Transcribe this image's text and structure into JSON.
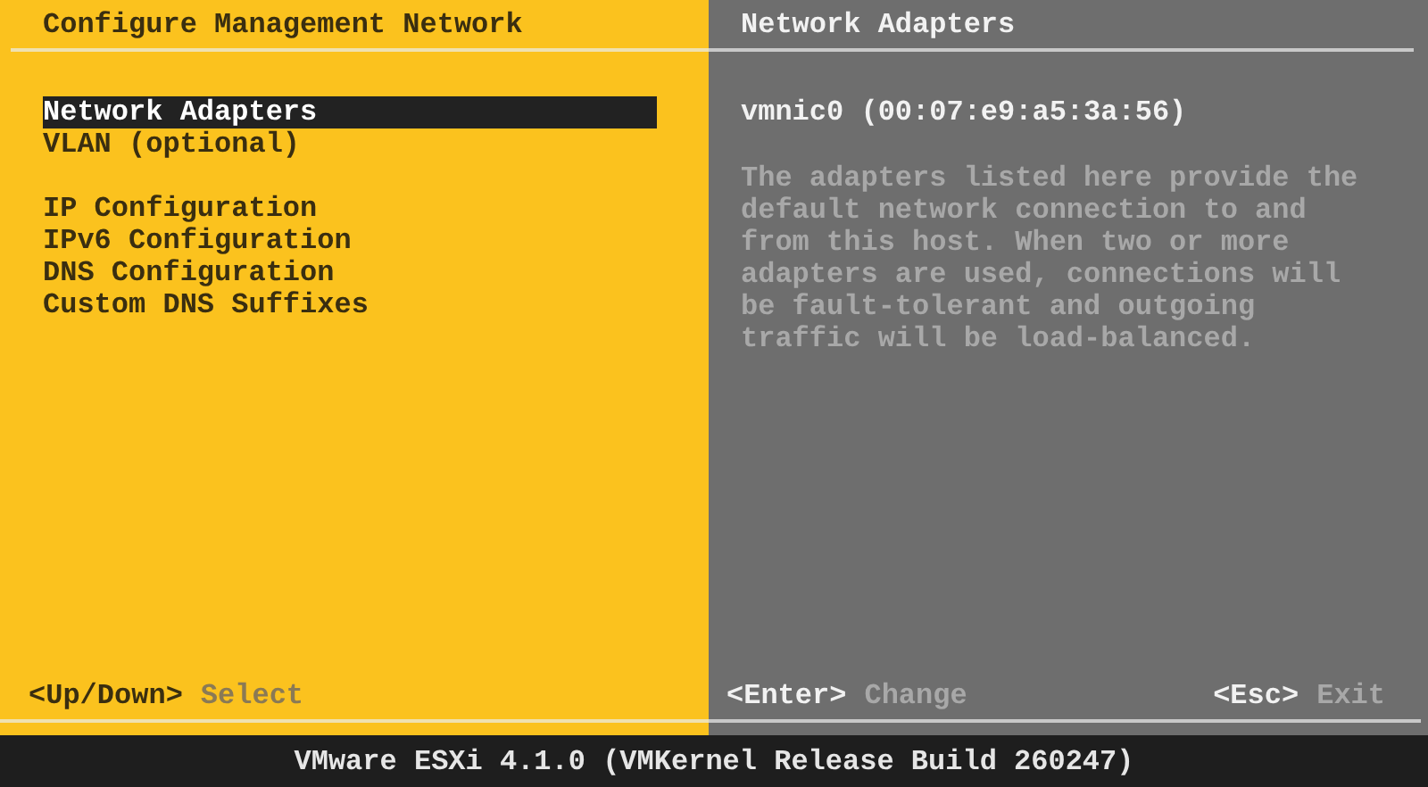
{
  "left_panel": {
    "title": "Configure Management Network",
    "menu_groups": [
      {
        "items": [
          {
            "label": "Network Adapters",
            "selected": true
          },
          {
            "label": "VLAN (optional)",
            "selected": false
          }
        ]
      },
      {
        "items": [
          {
            "label": "IP Configuration",
            "selected": false
          },
          {
            "label": "IPv6 Configuration",
            "selected": false
          },
          {
            "label": "DNS Configuration",
            "selected": false
          },
          {
            "label": "Custom DNS Suffixes",
            "selected": false
          }
        ]
      }
    ],
    "hints": [
      {
        "key": "<Up/Down>",
        "action": "Select"
      }
    ]
  },
  "right_panel": {
    "title": "Network Adapters",
    "adapter": "vmnic0 (00:07:e9:a5:3a:56)",
    "description": "The adapters listed here provide the default network connection to and from this host. When two or more adapters are used, connections will be fault-tolerant and outgoing traffic will be load-balanced.",
    "hints": [
      {
        "key": "<Enter>",
        "action": "Change"
      },
      {
        "key": "<Esc>",
        "action": "Exit"
      }
    ]
  },
  "status_bar": "VMware ESXi 4.1.0 (VMKernel Release Build 260247)"
}
